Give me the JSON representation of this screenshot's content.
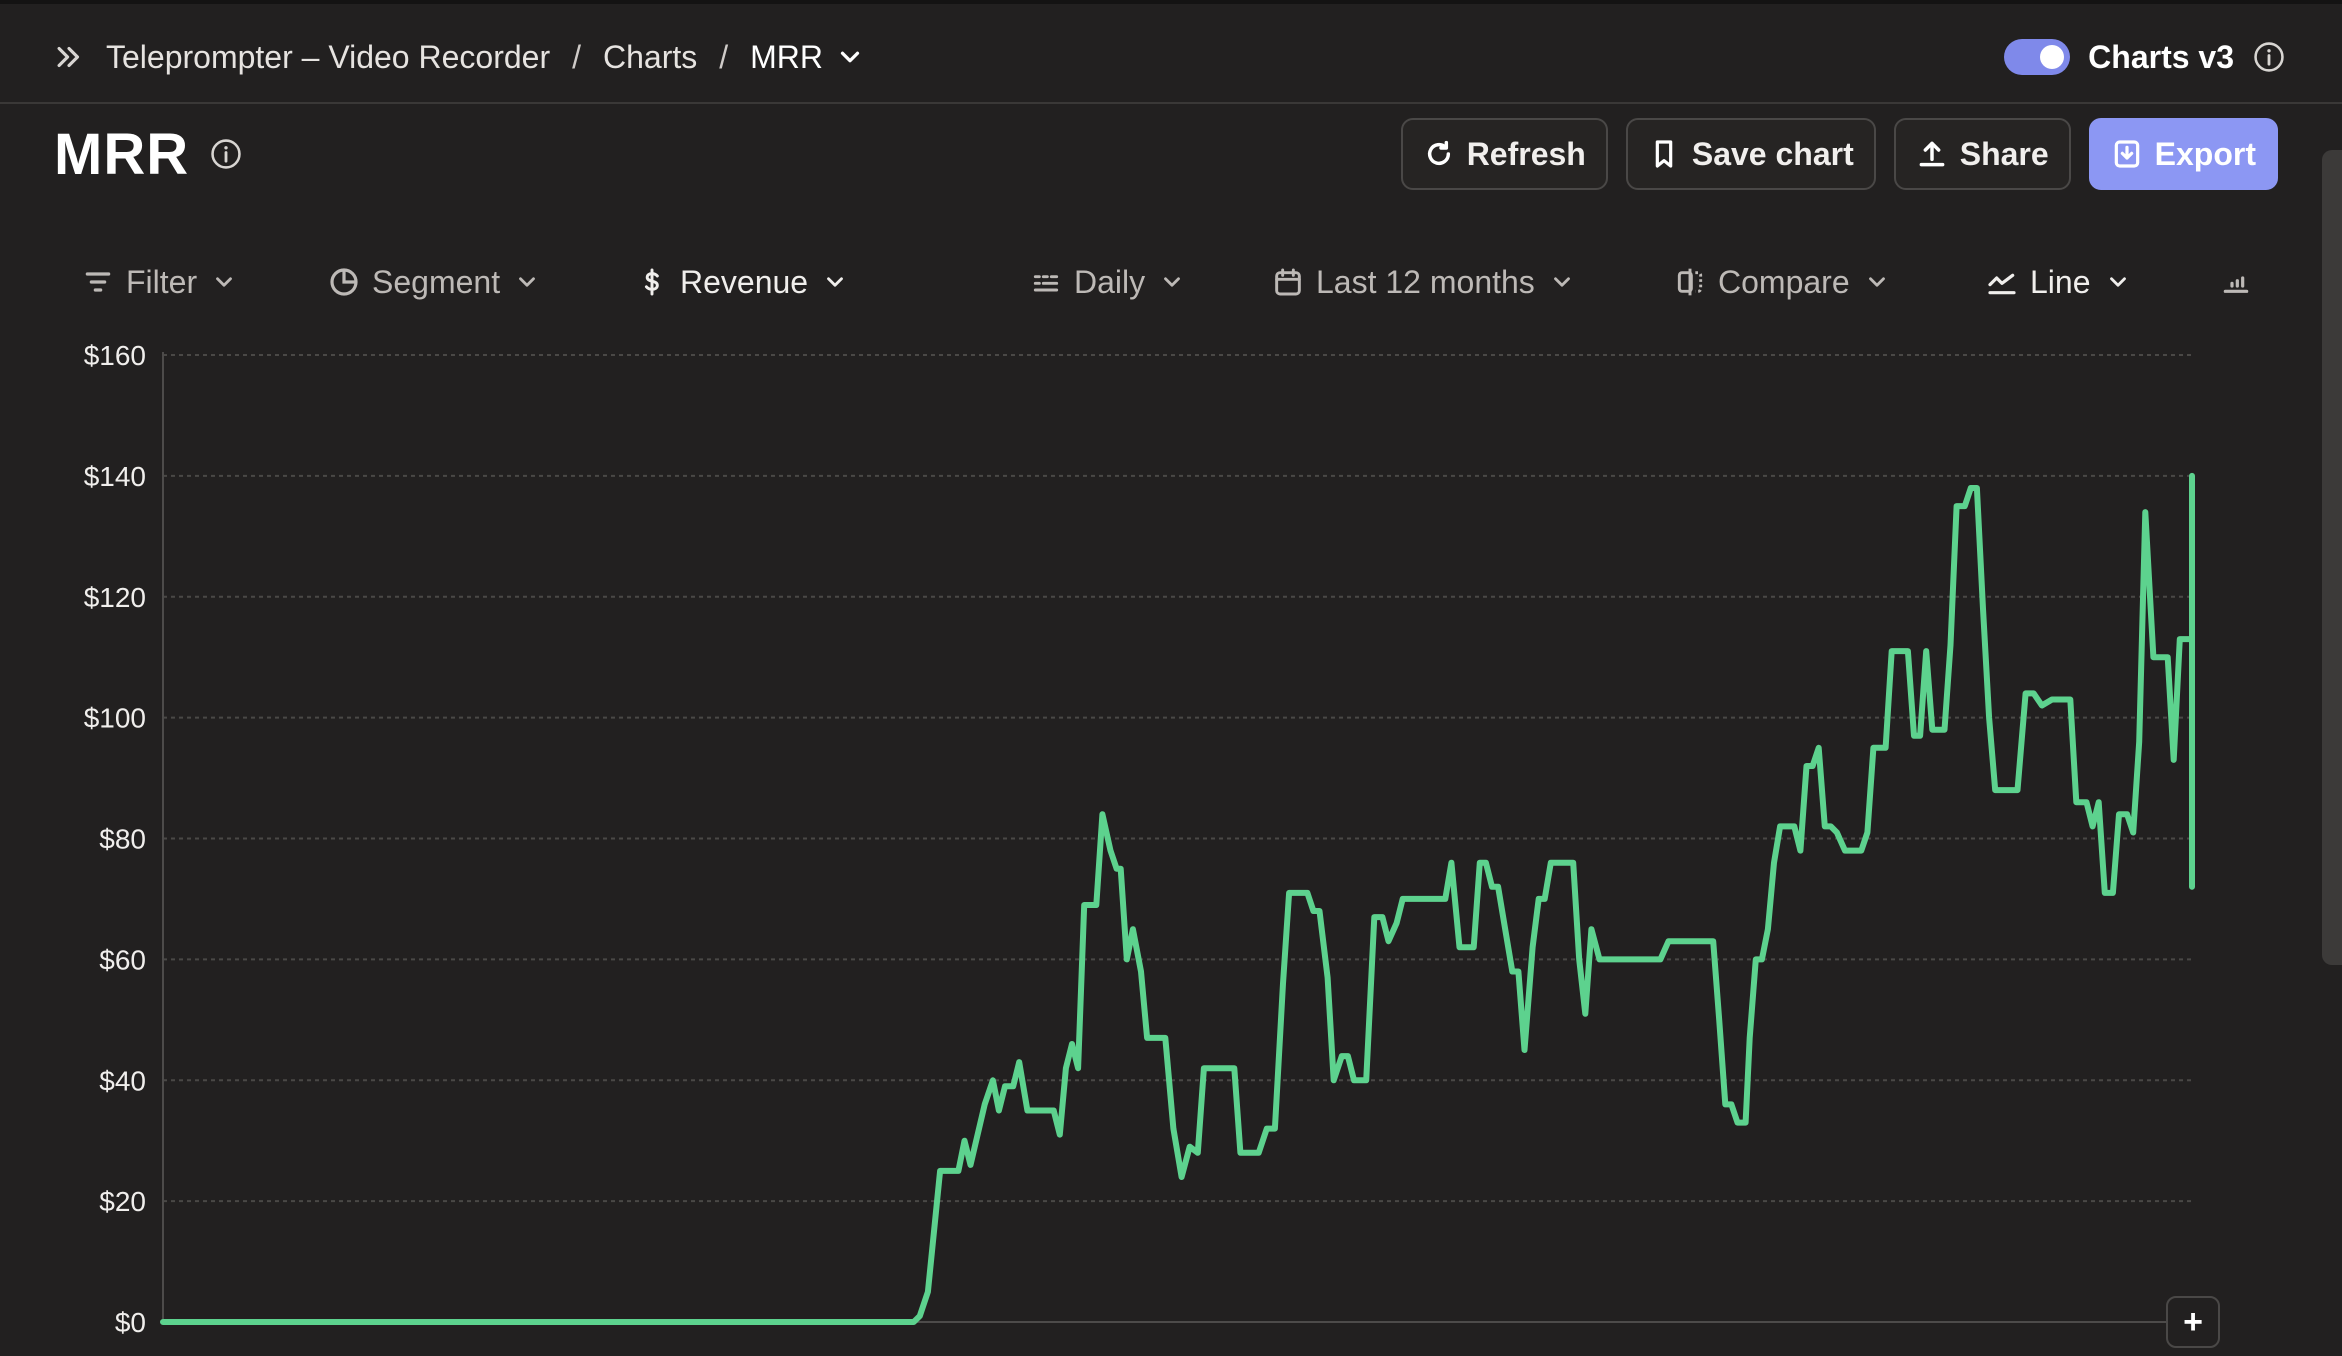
{
  "breadcrumb": {
    "app": "Teleprompter – Video Recorder",
    "section": "Charts",
    "current": "MRR",
    "separator": "/"
  },
  "header_right": {
    "label": "Charts v3",
    "toggle_on": true
  },
  "page": {
    "title": "MRR"
  },
  "actions": {
    "refresh": "Refresh",
    "save": "Save chart",
    "share": "Share",
    "export": "Export"
  },
  "toolbar": {
    "filter": "Filter",
    "segment": "Segment",
    "metric": "Revenue",
    "interval": "Daily",
    "range": "Last 12 months",
    "compare": "Compare",
    "chart_type": "Line"
  },
  "add_button": "+",
  "colors": {
    "accent": "#8c97f3",
    "series": "#5dd28e",
    "background": "#222020"
  },
  "chart_data": {
    "type": "line",
    "title": "MRR",
    "xlabel": "",
    "ylabel": "",
    "ylim": [
      0,
      160
    ],
    "y_ticks": [
      "$0",
      "$20",
      "$40",
      "$60",
      "$80",
      "$100",
      "$120",
      "$140",
      "$160"
    ],
    "y_tick_values": [
      0,
      20,
      40,
      60,
      80,
      100,
      120,
      140,
      160
    ],
    "grid": true,
    "legend": "none",
    "x_range": [
      0,
      1
    ],
    "series": [
      {
        "values": [
          [
            0.0,
            0
          ],
          [
            0.37,
            0
          ],
          [
            0.373,
            1
          ],
          [
            0.377,
            5
          ],
          [
            0.383,
            25
          ],
          [
            0.392,
            25
          ],
          [
            0.395,
            30
          ],
          [
            0.398,
            26
          ],
          [
            0.405,
            36
          ],
          [
            0.409,
            40
          ],
          [
            0.412,
            35
          ],
          [
            0.415,
            39
          ],
          [
            0.419,
            39
          ],
          [
            0.422,
            43
          ],
          [
            0.426,
            35
          ],
          [
            0.433,
            35
          ],
          [
            0.439,
            35
          ],
          [
            0.442,
            31
          ],
          [
            0.445,
            42
          ],
          [
            0.448,
            46
          ],
          [
            0.451,
            42
          ],
          [
            0.454,
            69
          ],
          [
            0.457,
            69
          ],
          [
            0.46,
            69
          ],
          [
            0.463,
            84
          ],
          [
            0.467,
            78
          ],
          [
            0.47,
            75
          ],
          [
            0.472,
            75
          ],
          [
            0.475,
            60
          ],
          [
            0.478,
            65
          ],
          [
            0.482,
            58
          ],
          [
            0.485,
            47
          ],
          [
            0.49,
            47
          ],
          [
            0.494,
            47
          ],
          [
            0.498,
            32
          ],
          [
            0.502,
            24
          ],
          [
            0.506,
            29
          ],
          [
            0.51,
            28
          ],
          [
            0.513,
            42
          ],
          [
            0.519,
            42
          ],
          [
            0.524,
            42
          ],
          [
            0.528,
            42
          ],
          [
            0.531,
            28
          ],
          [
            0.536,
            28
          ],
          [
            0.54,
            28
          ],
          [
            0.544,
            32
          ],
          [
            0.548,
            32
          ],
          [
            0.552,
            56
          ],
          [
            0.555,
            71
          ],
          [
            0.56,
            71
          ],
          [
            0.564,
            71
          ],
          [
            0.567,
            68
          ],
          [
            0.57,
            68
          ],
          [
            0.574,
            57
          ],
          [
            0.577,
            40
          ],
          [
            0.581,
            44
          ],
          [
            0.584,
            44
          ],
          [
            0.587,
            40
          ],
          [
            0.59,
            40
          ],
          [
            0.593,
            40
          ],
          [
            0.597,
            67
          ],
          [
            0.601,
            67
          ],
          [
            0.604,
            63
          ],
          [
            0.608,
            66
          ],
          [
            0.611,
            70
          ],
          [
            0.616,
            70
          ],
          [
            0.62,
            70
          ],
          [
            0.625,
            70
          ],
          [
            0.629,
            70
          ],
          [
            0.632,
            70
          ],
          [
            0.635,
            76
          ],
          [
            0.639,
            62
          ],
          [
            0.643,
            62
          ],
          [
            0.646,
            62
          ],
          [
            0.649,
            76
          ],
          [
            0.652,
            76
          ],
          [
            0.655,
            72
          ],
          [
            0.658,
            72
          ],
          [
            0.662,
            64
          ],
          [
            0.665,
            58
          ],
          [
            0.668,
            58
          ],
          [
            0.671,
            45
          ],
          [
            0.675,
            62
          ],
          [
            0.678,
            70
          ],
          [
            0.681,
            70
          ],
          [
            0.684,
            76
          ],
          [
            0.688,
            76
          ],
          [
            0.692,
            76
          ],
          [
            0.695,
            76
          ],
          [
            0.698,
            60
          ],
          [
            0.701,
            51
          ],
          [
            0.704,
            65
          ],
          [
            0.708,
            60
          ],
          [
            0.713,
            60
          ],
          [
            0.718,
            60
          ],
          [
            0.723,
            60
          ],
          [
            0.728,
            60
          ],
          [
            0.732,
            60
          ],
          [
            0.738,
            60
          ],
          [
            0.742,
            63
          ],
          [
            0.746,
            63
          ],
          [
            0.75,
            63
          ],
          [
            0.755,
            63
          ],
          [
            0.759,
            63
          ],
          [
            0.764,
            63
          ],
          [
            0.767,
            50
          ],
          [
            0.77,
            36
          ],
          [
            0.773,
            36
          ],
          [
            0.776,
            33
          ],
          [
            0.78,
            33
          ],
          [
            0.782,
            47
          ],
          [
            0.785,
            60
          ],
          [
            0.788,
            60
          ],
          [
            0.791,
            65
          ],
          [
            0.794,
            76
          ],
          [
            0.797,
            82
          ],
          [
            0.8,
            82
          ],
          [
            0.804,
            82
          ],
          [
            0.807,
            78
          ],
          [
            0.81,
            92
          ],
          [
            0.813,
            92
          ],
          [
            0.816,
            95
          ],
          [
            0.819,
            82
          ],
          [
            0.822,
            82
          ],
          [
            0.825,
            81
          ],
          [
            0.829,
            78
          ],
          [
            0.833,
            78
          ],
          [
            0.837,
            78
          ],
          [
            0.84,
            81
          ],
          [
            0.843,
            95
          ],
          [
            0.846,
            95
          ],
          [
            0.849,
            95
          ],
          [
            0.852,
            111
          ],
          [
            0.856,
            111
          ],
          [
            0.86,
            111
          ],
          [
            0.863,
            97
          ],
          [
            0.866,
            97
          ],
          [
            0.869,
            111
          ],
          [
            0.872,
            98
          ],
          [
            0.875,
            98
          ],
          [
            0.878,
            98
          ],
          [
            0.881,
            112
          ],
          [
            0.884,
            135
          ],
          [
            0.888,
            135
          ],
          [
            0.891,
            138
          ],
          [
            0.894,
            138
          ],
          [
            0.897,
            118
          ],
          [
            0.9,
            100
          ],
          [
            0.903,
            88
          ],
          [
            0.907,
            88
          ],
          [
            0.911,
            88
          ],
          [
            0.914,
            88
          ],
          [
            0.918,
            104
          ],
          [
            0.922,
            104
          ],
          [
            0.926,
            102
          ],
          [
            0.931,
            103
          ],
          [
            0.936,
            103
          ],
          [
            0.94,
            103
          ],
          [
            0.943,
            86
          ],
          [
            0.948,
            86
          ],
          [
            0.951,
            82
          ],
          [
            0.954,
            86
          ],
          [
            0.957,
            71
          ],
          [
            0.961,
            71
          ],
          [
            0.964,
            84
          ],
          [
            0.968,
            84
          ],
          [
            0.971,
            81
          ],
          [
            0.974,
            96
          ],
          [
            0.977,
            134
          ],
          [
            0.981,
            110
          ],
          [
            0.985,
            110
          ],
          [
            0.988,
            110
          ],
          [
            0.991,
            93
          ],
          [
            0.994,
            113
          ],
          [
            0.998,
            113
          ],
          [
            1.003,
            113
          ],
          [
            1.007,
            113
          ],
          [
            1.01,
            93
          ],
          [
            1.014,
            93
          ],
          [
            1.018,
            72
          ],
          [
            1.021,
            76
          ],
          [
            1.024,
            110
          ],
          [
            1.028,
            110
          ],
          [
            1.031,
            114
          ],
          [
            1.034,
            140
          ],
          [
            1.038,
            140
          ],
          [
            1.041,
            126
          ],
          [
            1.044,
            136
          ],
          [
            1.048,
            137
          ],
          [
            1.052,
            137
          ]
        ]
      }
    ]
  }
}
